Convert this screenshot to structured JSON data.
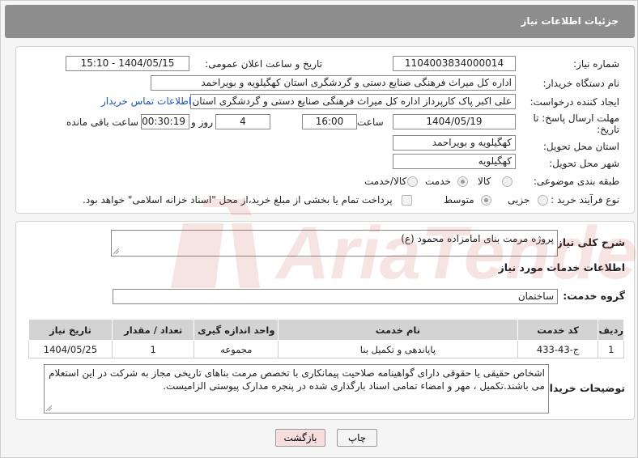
{
  "header": {
    "title": "جزئیات اطلاعات نیاز"
  },
  "fields": {
    "need_number_label": "شماره نیاز:",
    "need_number": "1104003834000014",
    "announce_label": "تاریخ و ساعت اعلان عمومی:",
    "announce_value": "1404/05/15 - 15:10",
    "buyer_org_label": "نام دستگاه خریدار:",
    "buyer_org": "اداره کل میراث فرهنگی  صنایع دستی و گردشگری استان کهگیلویه و بویراحمد",
    "creator_label": "ایجاد کننده درخواست:",
    "creator": "علی اکبر پاک کارپرداز اداره کل میراث فرهنگی  صنایع دستی و گردشگری استان کهگیلویه و بویراحمد",
    "contact_link": "اطلاعات تماس خریدار",
    "deadline_label_1": "مهلت ارسال پاسخ: تا",
    "deadline_label_2": "تاریخ:",
    "deadline_date": "1404/05/19",
    "time_label": "ساعت",
    "deadline_time": "16:00",
    "days_value": "4",
    "days_label": "روز و",
    "remaining_time": "00:30:19",
    "remaining_label": "ساعت باقی مانده",
    "province_label": "استان محل تحویل:",
    "province": "کهگیلویه و بویراحمد",
    "city_label": "شهر محل تحویل:",
    "city": "کهگیلویه",
    "category_label": "طبقه بندی موضوعی:",
    "category_options": [
      "کالا",
      "خدمت",
      "کالا/خدمت"
    ],
    "category_selected": "خدمت",
    "process_label": "نوع فرآیند خرید :",
    "process_options": [
      "جزیی",
      "متوسط"
    ],
    "process_selected": "متوسط",
    "payment_note": "پرداخت تمام یا بخشی از مبلغ خرید،از محل \"اسناد خزانه اسلامی\" خواهد بود."
  },
  "summary": {
    "label": "شرح کلی نیاز:",
    "text": "پروژه مرمت بنای امامزاده محمود (ع)"
  },
  "services": {
    "heading": "اطلاعات خدمات مورد نیاز",
    "group_label": "گروه خدمت:",
    "group_value": "ساختمان",
    "columns": [
      "ردیف",
      "کد خدمت",
      "نام خدمت",
      "واحد اندازه گیری",
      "تعداد / مقدار",
      "تاریخ نیاز"
    ],
    "rows": [
      [
        "1",
        "ج-43-433",
        "پایاندهی و تکمیل بنا",
        "مجموعه",
        "1",
        "1404/05/25"
      ]
    ]
  },
  "buyer_notes": {
    "label": "توضیحات خریدار:",
    "text": "اشخاص حقیقی یا حقوقی دارای گواهینامه صلاحیت پیمانکاری با تخصص مرمت بناهای تاریخی مجاز به شرکت در این استعلام می باشند.تکمیل ، مهر و امضاء تمامی اسناد بارگذاری شده در پنجره مدارک پیوستی الزامیست."
  },
  "buttons": {
    "print": "چاپ",
    "back": "بازگشت"
  },
  "watermark": {
    "text": "AriaTender.net"
  },
  "colors": {
    "header_bg": "#8d8d8d",
    "link": "#1a56c4",
    "back_btn_bg": "#f7dede",
    "table_header": "#d3d3d3",
    "watermark": "#c0392b"
  }
}
